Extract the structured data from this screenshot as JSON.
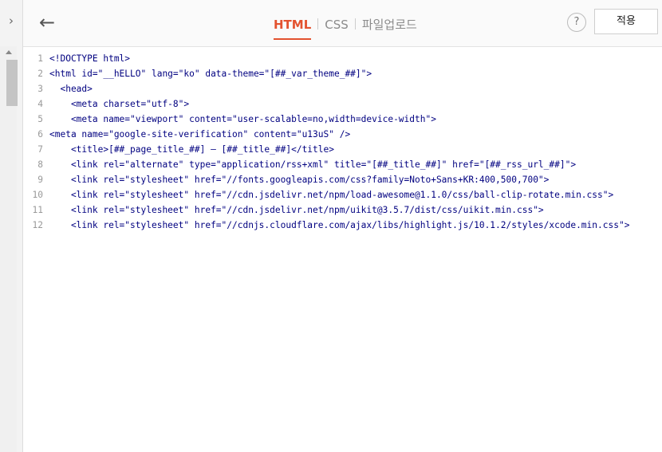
{
  "toolbar": {
    "tabs": [
      {
        "label": "HTML",
        "active": true
      },
      {
        "label": "CSS",
        "active": false
      },
      {
        "label": "파일업로드",
        "active": false
      }
    ],
    "help": "?",
    "apply": "적용"
  },
  "colors": {
    "accent": "#e3522f"
  },
  "code": {
    "lines": [
      {
        "n": "1",
        "text": "<!DOCTYPE html>"
      },
      {
        "n": "2",
        "text": "<html id=\"__hELLO\" lang=\"ko\" data-theme=\"[##_var_theme_##]\">"
      },
      {
        "n": "3",
        "text": "  <head>"
      },
      {
        "n": "4",
        "text": "    <meta charset=\"utf-8\">"
      },
      {
        "n": "5",
        "text": "    <meta name=\"viewport\" content=\"user-scalable=no,width=device-width\">"
      },
      {
        "n": "6",
        "text": "<meta name=\"google-site-verification\" content=\"u13uS\" />"
      },
      {
        "n": "7",
        "text": "    <title>[##_page_title_##] – [##_title_##]</title>"
      },
      {
        "n": "8",
        "text": "    <link rel=\"alternate\" type=\"application/rss+xml\" title=\"[##_title_##]\" href=\"[##_rss_url_##]\">"
      },
      {
        "n": "9",
        "text": "    <link rel=\"stylesheet\" href=\"//fonts.googleapis.com/css?family=Noto+Sans+KR:400,500,700\">"
      },
      {
        "n": "10",
        "text": "    <link rel=\"stylesheet\" href=\"//cdn.jsdelivr.net/npm/load-awesome@1.1.0/css/ball-clip-rotate.min.css\">"
      },
      {
        "n": "11",
        "text": "    <link rel=\"stylesheet\" href=\"//cdn.jsdelivr.net/npm/uikit@3.5.7/dist/css/uikit.min.css\">"
      },
      {
        "n": "12",
        "text": "    <link rel=\"stylesheet\" href=\"//cdnjs.cloudflare.com/ajax/libs/highlight.js/10.1.2/styles/xcode.min.css\">"
      }
    ]
  }
}
